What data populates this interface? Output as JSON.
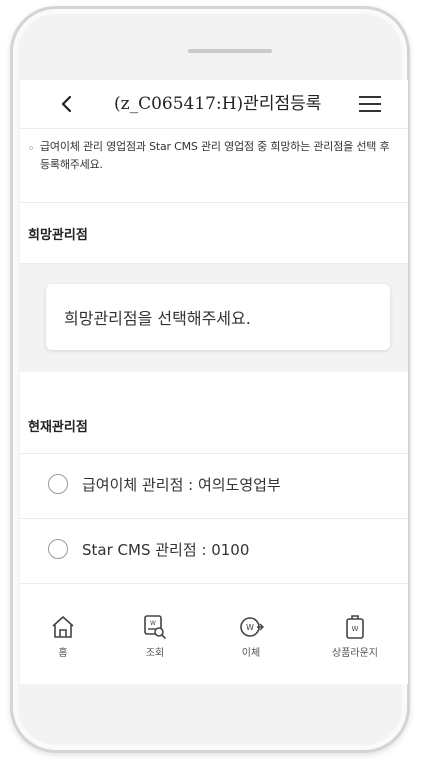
{
  "header": {
    "title": "(z_C065417:H)관리점등록",
    "back_icon": "chevron-left-icon",
    "menu_icon": "hamburger-menu-icon"
  },
  "notice": {
    "bullet": "◦",
    "text": "급여이체 관리 영업점과 Star CMS 관리 영업점 중 희망하는 관리점을 선택 후 등록해주세요."
  },
  "hope_branch": {
    "title": "희망관리점",
    "placeholder": "희망관리점을 선택해주세요."
  },
  "current_branch": {
    "title": "현재관리점",
    "options": [
      {
        "label": "급여이체 관리점 : 여의도영업부",
        "selected": false
      },
      {
        "label": "Star CMS 관리점 : 0100",
        "selected": false
      }
    ]
  },
  "tabbar": {
    "items": [
      {
        "label": "홈",
        "icon": "home-icon"
      },
      {
        "label": "조회",
        "icon": "inquiry-icon"
      },
      {
        "label": "이체",
        "icon": "transfer-icon"
      },
      {
        "label": "상품라운지",
        "icon": "product-lounge-icon"
      }
    ]
  },
  "colors": {
    "frame": "#d4d4d4",
    "background": "#f3f3f3",
    "text": "#222222"
  }
}
